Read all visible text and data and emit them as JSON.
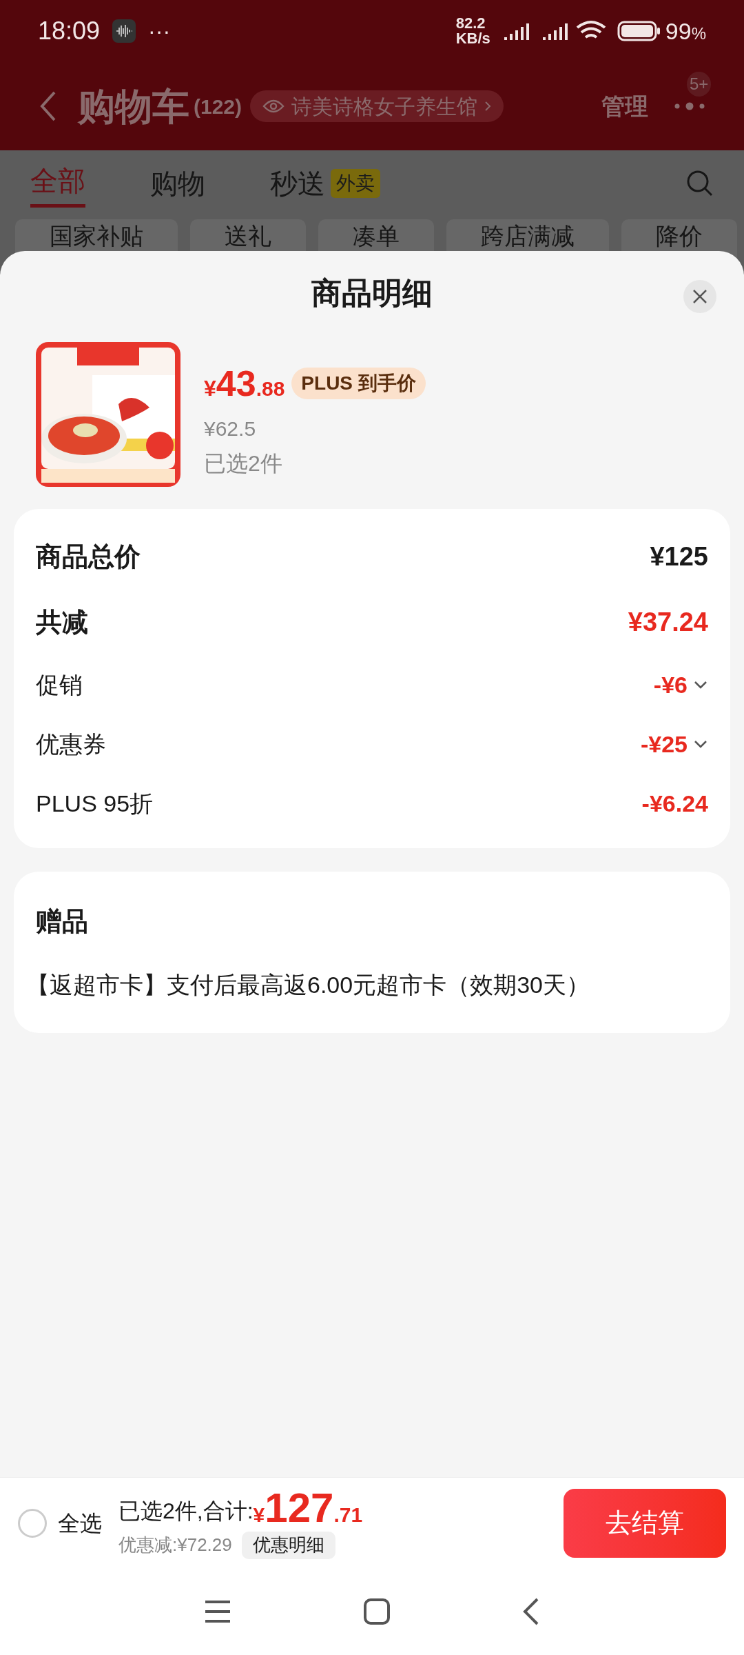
{
  "status_bar": {
    "time": "18:09",
    "more": "···",
    "speed_value": "82.2",
    "speed_unit": "KB/s",
    "battery": "99",
    "battery_unit": "%"
  },
  "header": {
    "title": "购物车",
    "count": "(122)",
    "shop": "诗美诗格女子养生馆",
    "manage": "管理",
    "badge": "5+"
  },
  "tabs": [
    {
      "label": "全部",
      "selected": true
    },
    {
      "label": "购物",
      "selected": false
    },
    {
      "label": "秒送",
      "tag": "外卖",
      "selected": false
    }
  ],
  "chips": [
    "国家补贴",
    "送礼",
    "凑单",
    "跨店满减",
    "降价"
  ],
  "sheet": {
    "title": "商品明细",
    "product": {
      "currency": "¥",
      "price_int": "43",
      "price_dec": ".88",
      "badge": "PLUS 到手价",
      "original_price": "¥62.5",
      "quantity": "已选2件"
    },
    "summary": [
      {
        "kind": "total",
        "label": "商品总价",
        "value": "¥125"
      },
      {
        "kind": "reduction",
        "label": "共减",
        "value": "¥37.24"
      },
      {
        "kind": "detail",
        "label": "促销",
        "value": "-¥6",
        "expandable": true
      },
      {
        "kind": "detail",
        "label": "优惠券",
        "value": "-¥25",
        "expandable": true
      },
      {
        "kind": "detail",
        "label": "PLUS 95折",
        "value": "-¥6.24",
        "expandable": false
      }
    ],
    "gift": {
      "title": "赠品",
      "text": "【返超市卡】支付后最高返6.00元超市卡（效期30天）"
    }
  },
  "bottom_bar": {
    "select_all": {
      "label": "全选",
      "checked": false
    },
    "summary": "已选2件,合计:",
    "currency": "¥",
    "total_int": "127",
    "total_dec": ".71",
    "discount": "优惠减:¥72.29",
    "detail_button": "优惠明细",
    "checkout": "去结算"
  }
}
